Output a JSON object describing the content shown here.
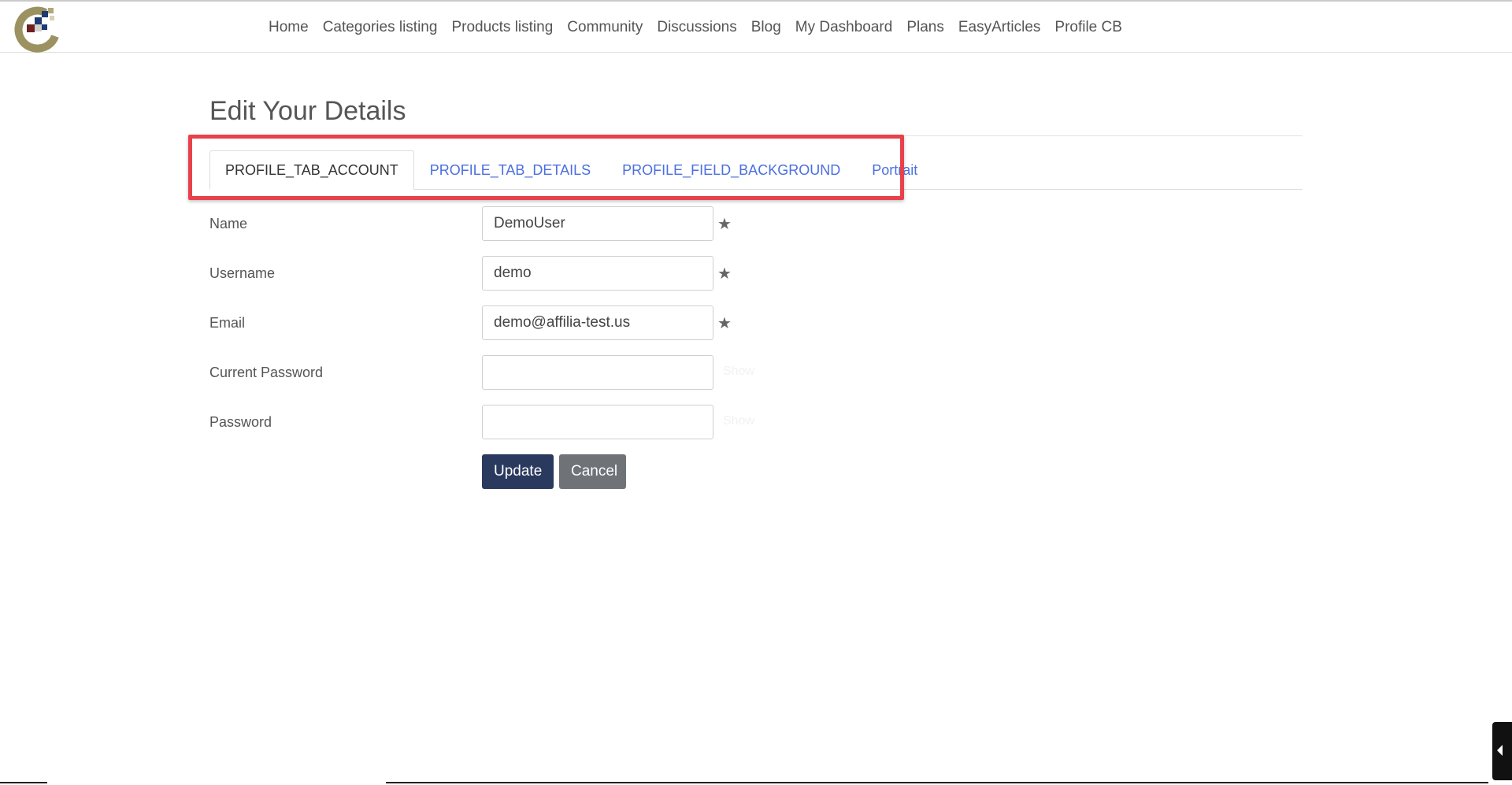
{
  "nav": {
    "items": [
      "Home",
      "Categories listing",
      "Products listing",
      "Community",
      "Discussions",
      "Blog",
      "My Dashboard",
      "Plans",
      "EasyArticles",
      "Profile CB"
    ]
  },
  "page": {
    "title": "Edit Your Details"
  },
  "tabs": [
    {
      "label": "PROFILE_TAB_ACCOUNT",
      "active": true
    },
    {
      "label": "PROFILE_TAB_DETAILS",
      "active": false
    },
    {
      "label": "PROFILE_FIELD_BACKGROUND",
      "active": false
    },
    {
      "label": "Portrait",
      "active": false
    }
  ],
  "form": {
    "name": {
      "label": "Name",
      "value": "DemoUser"
    },
    "username": {
      "label": "Username",
      "value": "demo"
    },
    "email": {
      "label": "Email",
      "value": "demo@affilia-test.us"
    },
    "current_password": {
      "label": "Current Password",
      "value": "",
      "show_label": "Show"
    },
    "password": {
      "label": "Password",
      "value": "",
      "show_label": "Show"
    }
  },
  "buttons": {
    "update": "Update",
    "cancel": "Cancel"
  },
  "colors": {
    "highlight_border": "#e8414b",
    "tab_link": "#4b6fe0",
    "update_button": "#2a3a5e",
    "cancel_button": "#6f7378"
  },
  "icons": {
    "required": "star-icon",
    "side_toggle": "caret-left-icon"
  }
}
